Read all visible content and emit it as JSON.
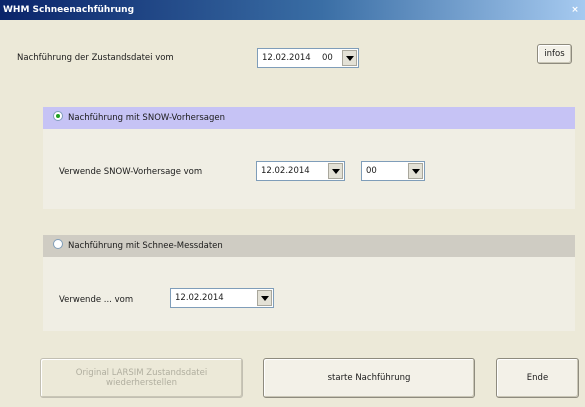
{
  "window": {
    "title": "WHM Schneenachführung",
    "close_glyph": "×"
  },
  "top": {
    "label": "Nachführung der Zustandsdatei vom",
    "combo_date": "12.02.2014",
    "combo_hour": "00",
    "info_button": "infos"
  },
  "group_snow": {
    "radio_label": "Nachführung mit SNOW-Vorhersagen",
    "selected": true,
    "label": "Verwende SNOW-Vorhersage vom",
    "date": "12.02.2014",
    "hour": "00"
  },
  "group_mess": {
    "radio_label": "Nachführung mit Schnee-Messdaten",
    "selected": false,
    "label": "Verwende ... vom",
    "date": "12.02.2014"
  },
  "buttons": {
    "restore_line1": "Original LARSIM Zustandsdatei",
    "restore_line2": "wiederherstellen",
    "start": "starte Nachführung",
    "end": "Ende"
  },
  "colors": {
    "snow_header": "#c6c3f5",
    "mess_header": "#cfccc3"
  }
}
